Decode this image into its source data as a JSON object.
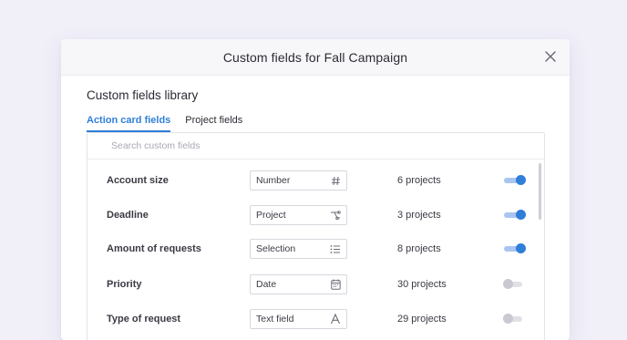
{
  "modal": {
    "title": "Custom fields for Fall Campaign"
  },
  "library": {
    "title": "Custom fields library",
    "tabs": [
      {
        "label": "Action card fields",
        "active": true
      },
      {
        "label": "Project fields",
        "active": false
      }
    ],
    "search": {
      "placeholder": "Search custom fields",
      "value": ""
    },
    "fields": [
      {
        "name": "Account size",
        "type": "Number",
        "icon": "hash-icon",
        "count": "6 projects",
        "enabled": true
      },
      {
        "name": "Deadline",
        "type": "Project",
        "icon": "project-link-icon",
        "count": "3 projects",
        "enabled": true
      },
      {
        "name": "Amount of requests",
        "type": "Selection",
        "icon": "list-icon",
        "count": "8 projects",
        "enabled": true
      },
      {
        "name": "Priority",
        "type": "Date",
        "icon": "calendar-icon",
        "count": "30 projects",
        "enabled": false
      },
      {
        "name": "Type of request",
        "type": "Text field",
        "icon": "text-icon",
        "count": "29 projects",
        "enabled": false
      }
    ]
  },
  "colors": {
    "accent": "#2f7fd8",
    "toggle_on_track": "#a9c5ef",
    "toggle_off": "#c9c9d1",
    "background": "#f1f0f9"
  }
}
